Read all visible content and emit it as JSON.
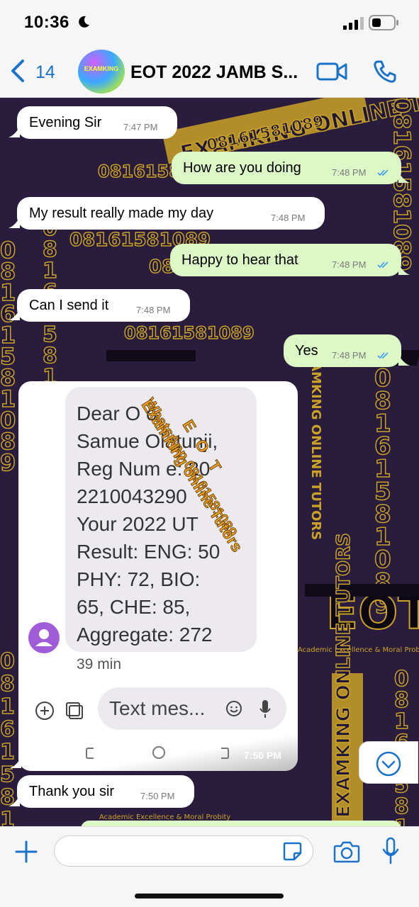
{
  "status_bar": {
    "time": "10:36"
  },
  "header": {
    "back_count": "14",
    "title": "EOT 2022 JAMB S...",
    "avatar_text": "EXAMKING"
  },
  "background_watermark": {
    "brand": "EXAMKING ONLINE TUTORS",
    "phone": "08161581089",
    "tagline": "Academic Excellence & Moral Probity",
    "logo": "EOT"
  },
  "messages": [
    {
      "dir": "in",
      "text": "Evening Sir",
      "time": "7:47 PM"
    },
    {
      "dir": "out",
      "text": "How are you doing",
      "time": "7:48 PM"
    },
    {
      "dir": "in",
      "text": "My result really made my day",
      "time": "7:48 PM"
    },
    {
      "dir": "out",
      "text": "Happy to hear that",
      "time": "7:48 PM"
    },
    {
      "dir": "in",
      "text": "Can  I send it",
      "time": "7:48 PM"
    },
    {
      "dir": "out",
      "text": "Yes",
      "time": "7:48 PM"
    },
    {
      "dir": "in",
      "text": "Thank you sir",
      "time": "7:50 PM"
    }
  ],
  "image_message": {
    "time": "7:50 PM",
    "sms_lines": [
      "Dear O o",
      "Samue  Olatunji,",
      "Reg Num e: 20",
      "2210043290",
      "Your 2022 UT",
      "Result: ENG: 50",
      "PHY: 72, BIO:",
      "65, CHE: 85,",
      "Aggregate: 272"
    ],
    "sms_age": "39 min",
    "input_placeholder": "Text mes...",
    "watermark_line1": "Examking online Tutors",
    "watermark_line2": "WhatsApp 08161581089",
    "watermark_eot": "EOT"
  }
}
